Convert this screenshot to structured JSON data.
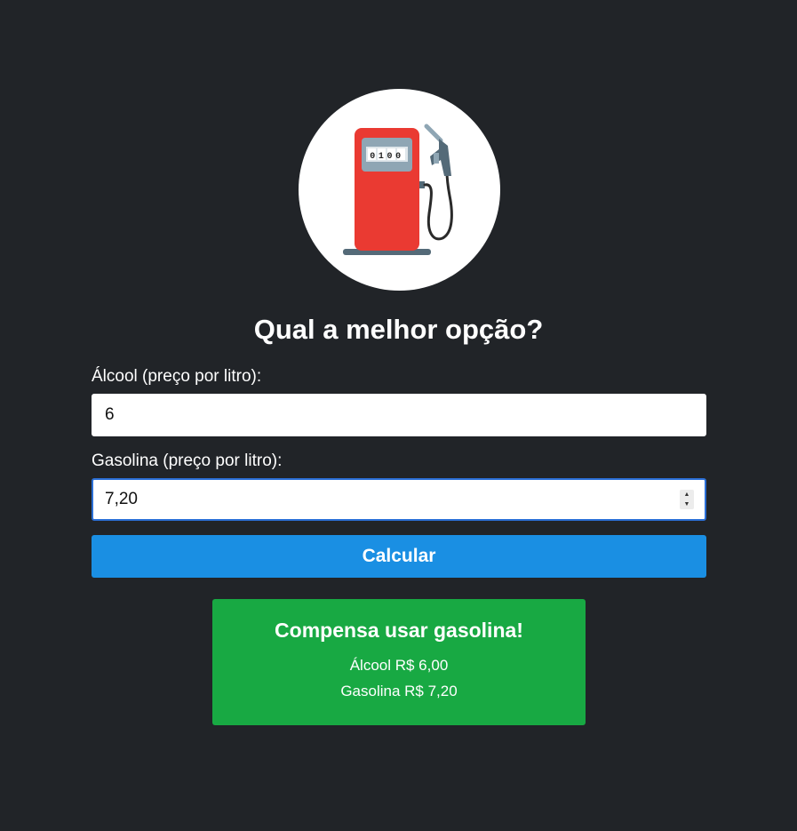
{
  "header": {
    "logo_icon": "fuel-pump-icon",
    "pump_display": "0100",
    "title": "Qual a melhor opção?"
  },
  "form": {
    "alcool_label": "Álcool (preço por litro):",
    "alcool_value": "6",
    "gasolina_label": "Gasolina (preço por litro):",
    "gasolina_value": "7,20",
    "submit_label": "Calcular"
  },
  "result": {
    "heading": "Compensa usar gasolina!",
    "alcool_line": "Álcool R$ 6,00",
    "gasolina_line": "Gasolina R$ 7,20"
  },
  "colors": {
    "background": "#212428",
    "button": "#1a8fe3",
    "result": "#18a943",
    "pump_body": "#ea3a32"
  }
}
